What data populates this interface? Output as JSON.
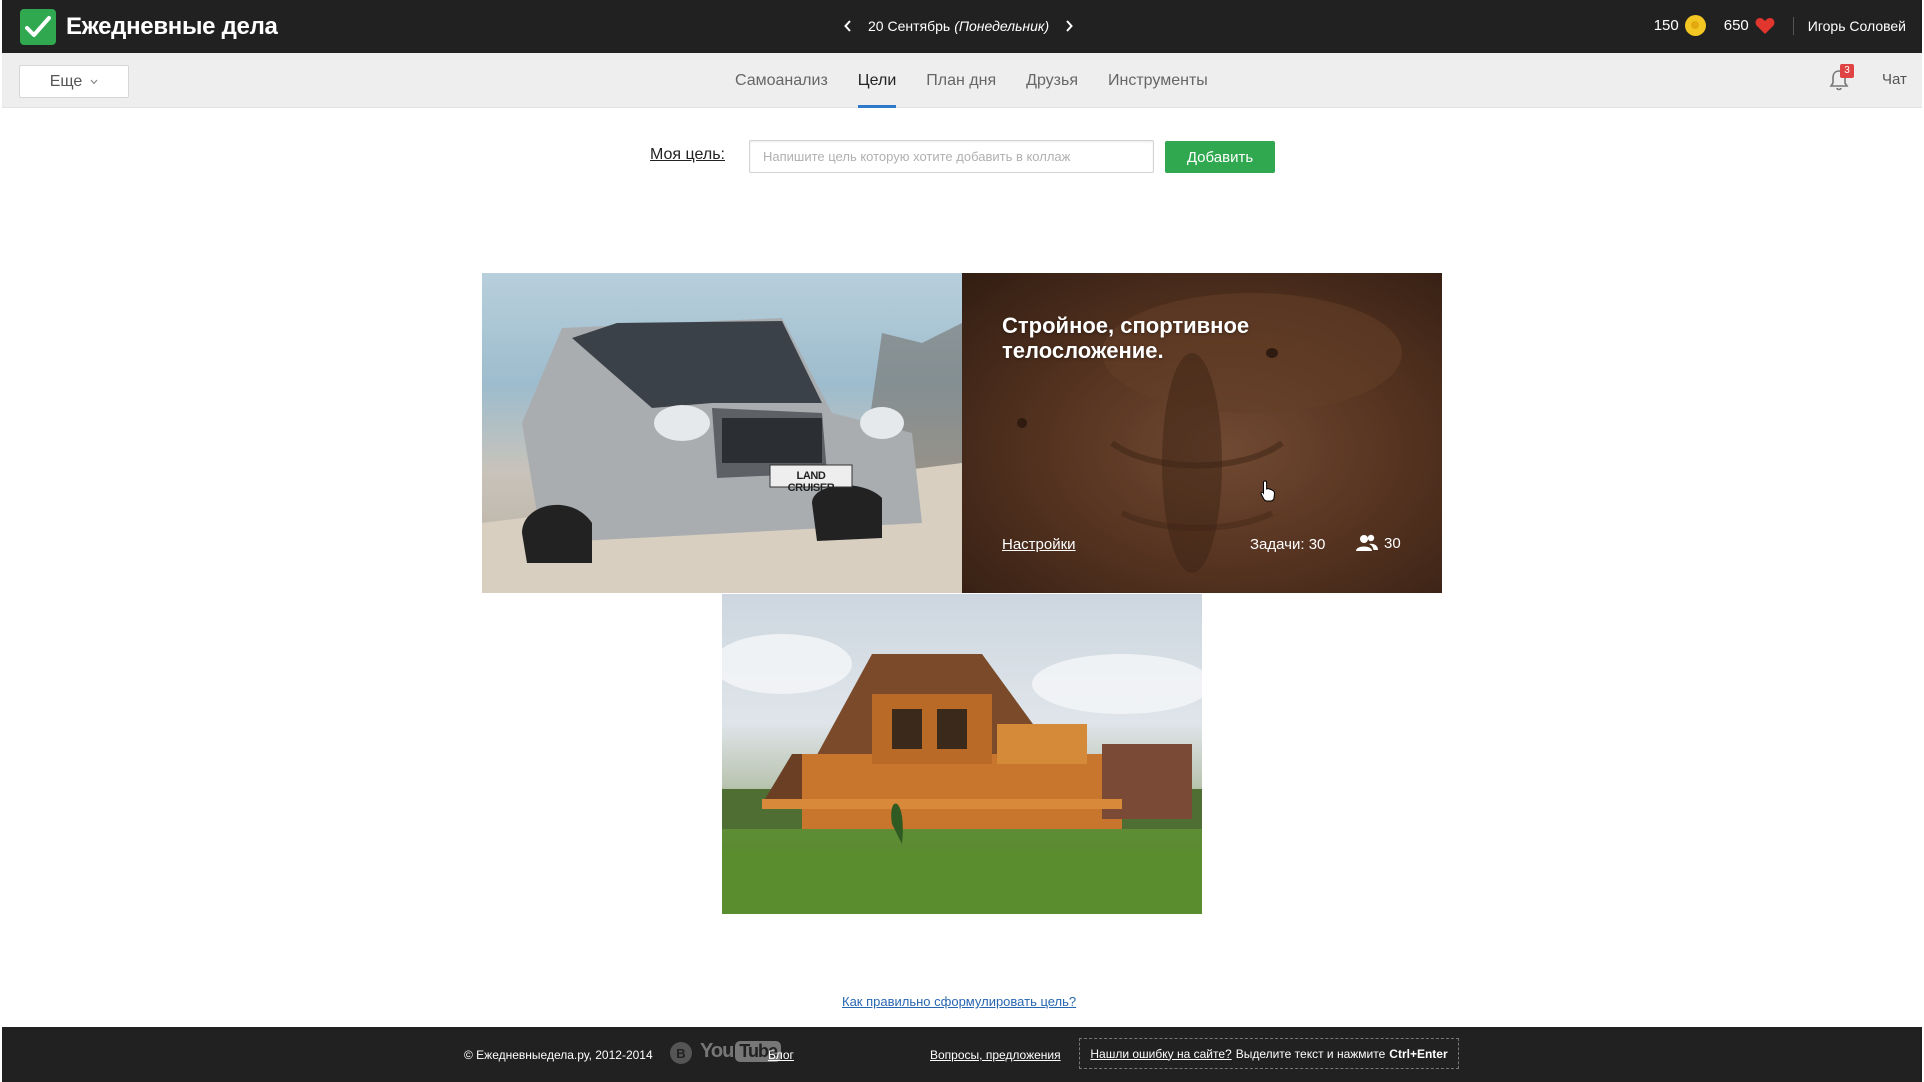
{
  "header": {
    "app_title": "Ежедневные дела",
    "date_day": "20 Сентябрь",
    "date_weekday": "(Понедельник)",
    "coins": "150",
    "hearts": "650",
    "username": "Игорь Соловей"
  },
  "nav": {
    "more_label": "Еще",
    "tabs": [
      {
        "label": "Самоанализ",
        "active": false
      },
      {
        "label": "Цели",
        "active": true
      },
      {
        "label": "План дня",
        "active": false
      },
      {
        "label": "Друзья",
        "active": false
      },
      {
        "label": "Инструменты",
        "active": false
      }
    ],
    "notifications_count": "3",
    "chat_label": "Чат"
  },
  "goal_form": {
    "label": "Моя цель:",
    "input_value": "",
    "input_placeholder": "Напишите цель которую хотите добавить в коллаж",
    "add_label": "Добавить"
  },
  "collage": {
    "car_badge": "LAND CRUISER",
    "hovered_tile": {
      "title": "Стройное, спортивное телосложение.",
      "settings_label": "Настройки",
      "tasks_label": "Задачи: 30",
      "people_count": "30"
    }
  },
  "help_link": "Как правильно сформулировать цель?",
  "footer": {
    "copyright": "© Ежедневныедела.ру, 2012-2014",
    "vk_label": "B",
    "youtube_you": "You",
    "youtube_tube": "Tube",
    "blog_label": "Блог",
    "feedback_label": "Вопросы, предложения",
    "error_link": "Нашли ошибку на сайте?",
    "error_text": "Выделите текст и нажмите",
    "error_keys": "Ctrl+Enter"
  },
  "colors": {
    "accent_green": "#2fa84f",
    "header_bg": "#212121",
    "tab_underline": "#2c7ac9",
    "link_blue": "#2766b0",
    "badge_red": "#e04343"
  }
}
